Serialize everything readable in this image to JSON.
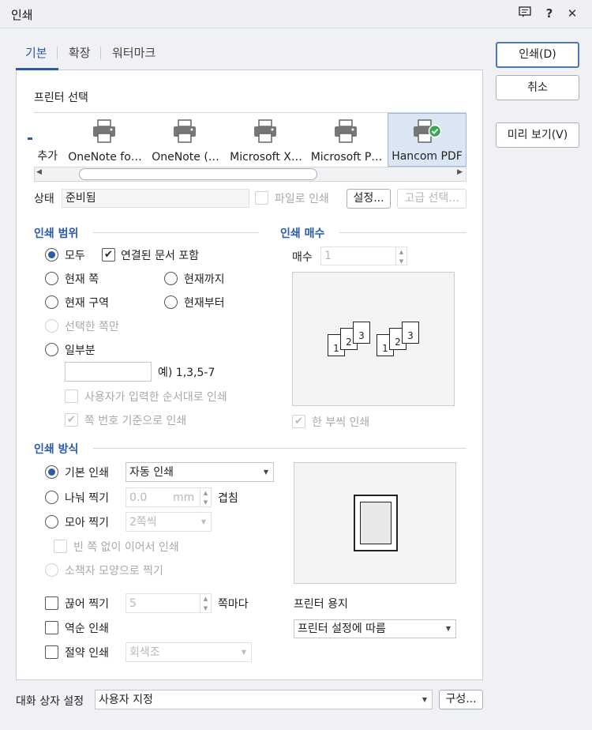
{
  "window": {
    "title": "인쇄",
    "icons": [
      "comment-icon",
      "help-icon",
      "close-icon"
    ],
    "help_glyph": "?",
    "close_glyph": "✕"
  },
  "tabs": [
    "기본",
    "확장",
    "워터마크"
  ],
  "actions": {
    "print": "인쇄(D)",
    "cancel": "취소",
    "preview": "미리 보기(V)"
  },
  "printer_select": {
    "label": "프린터 선택",
    "items": [
      {
        "label": "추가",
        "icon": "add-printer-icon"
      },
      {
        "label": "OneNote fo…",
        "icon": "printer-icon"
      },
      {
        "label": "OneNote (…",
        "icon": "printer-icon"
      },
      {
        "label": "Microsoft X…",
        "icon": "printer-icon"
      },
      {
        "label": "Microsoft P…",
        "icon": "printer-icon"
      },
      {
        "label": "Hancom PDF",
        "icon": "printer-check-icon",
        "selected": true
      }
    ],
    "status_label": "상태",
    "status_value": "준비됨",
    "print_to_file": "파일로 인쇄",
    "settings_button": "설정...",
    "advanced_button": "고급 선택..."
  },
  "print_range": {
    "title": "인쇄 범위",
    "all": "모두",
    "include_linked": "연결된 문서 포함",
    "current_page": "현재 쪽",
    "until_current": "현재까지",
    "current_section": "현재 구역",
    "from_current": "현재부터",
    "selected_pages": "선택한 쪽만",
    "partial": "일부분",
    "partial_value": "",
    "partial_example": "예) 1,3,5-7",
    "user_order": "사용자가 입력한 순서대로 인쇄",
    "page_number_basis": "쪽 번호 기준으로 인쇄"
  },
  "copies": {
    "title": "인쇄 매수",
    "label": "매수",
    "value": "1",
    "collate": "한 부씩 인쇄",
    "collate_pages": [
      "1",
      "2",
      "3",
      "1",
      "2",
      "3"
    ]
  },
  "print_method": {
    "title": "인쇄 방식",
    "basic": "기본 인쇄",
    "basic_value": "자동 인쇄",
    "split": "나눠 찍기",
    "split_value": "0.0",
    "split_unit": "mm",
    "overlap": "겹침",
    "collect": "모아 찍기",
    "collect_value": "2쪽씩",
    "no_blank": "빈 쪽 없이 이어서 인쇄",
    "booklet": "소책자 모양으로 찍기",
    "cut": "끊어 찍기",
    "cut_value": "5",
    "per_pages": "쪽마다",
    "reverse": "역순 인쇄",
    "economy": "절약 인쇄",
    "economy_value": "회색조",
    "paper_label": "프린터 용지",
    "paper_value": "프린터 설정에 따름"
  },
  "footer": {
    "label": "대화 상자 설정",
    "value": "사용자 지정",
    "configure": "구성..."
  },
  "colors": {
    "accent": "#2a5ba6",
    "check_green": "#3aa655"
  }
}
